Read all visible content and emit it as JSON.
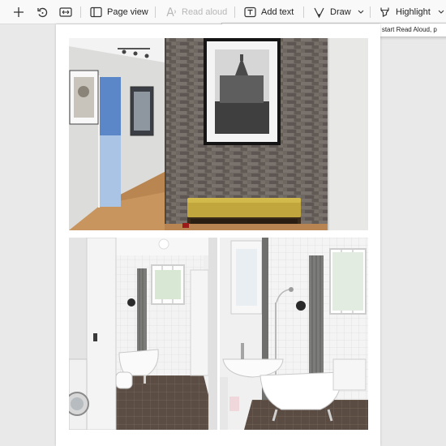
{
  "toolbar": {
    "page_view": "Page view",
    "read_aloud": "Read aloud",
    "add_text": "Add text",
    "draw": "Draw",
    "highlight": "Highlight"
  },
  "tooltip": {
    "text": "Read Aloud isn't available when Erase is selected. To start Read Aloud, p"
  },
  "colors": {
    "toolbar_bg": "#f9f9f9",
    "canvas_bg": "#e9e9e9",
    "disabled_text": "#b7b7b7"
  }
}
